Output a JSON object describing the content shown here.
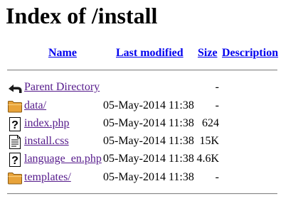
{
  "title": "Index of /install",
  "columns": {
    "name": "Name",
    "last_modified": "Last modified",
    "size": "Size",
    "description": "Description"
  },
  "entries": [
    {
      "icon": "back-icon",
      "name": "Parent Directory",
      "modified": "",
      "size": "-"
    },
    {
      "icon": "folder-icon",
      "name": "data/",
      "modified": "05-May-2014 11:38",
      "size": "-"
    },
    {
      "icon": "unknown-file-icon",
      "name": "index.php",
      "modified": "05-May-2014 11:38",
      "size": "624"
    },
    {
      "icon": "text-file-icon",
      "name": "install.css",
      "modified": "05-May-2014 11:38",
      "size": "15K"
    },
    {
      "icon": "unknown-file-icon",
      "name": "language_en.php",
      "modified": "05-May-2014 11:38",
      "size": "4.6K"
    },
    {
      "icon": "folder-icon",
      "name": "templates/",
      "modified": "05-May-2014 11:38",
      "size": "-"
    }
  ]
}
